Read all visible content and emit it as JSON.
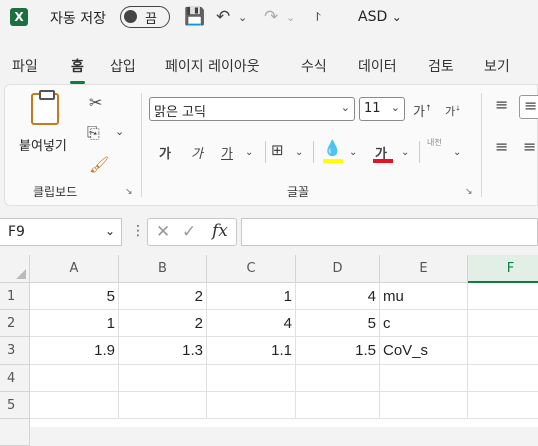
{
  "titlebar": {
    "app_logo": "X",
    "autosave_label": "자동 저장",
    "autosave_state": "끔",
    "doc_name": "ASD"
  },
  "menu": {
    "tabs": [
      "파일",
      "홈",
      "삽입",
      "페이지 레이아웃",
      "수식",
      "데이터",
      "검토",
      "보기"
    ],
    "active": "홈"
  },
  "ribbon": {
    "clipboard": {
      "paste_label": "붙여넣기",
      "group_label": "클립보드"
    },
    "font": {
      "family": "맑은 고딕",
      "size": "11",
      "grow_label": "가",
      "shrink_label": "가",
      "bold_label": "가",
      "italic_label": "가",
      "underline_label": "가",
      "font_color_label": "가",
      "phonetic_label": "내천",
      "group_label": "글꼴",
      "highlight_color": "#ffff00",
      "font_color": "#e81123"
    }
  },
  "formula_bar": {
    "name_box": "F9",
    "fx_label": "fx",
    "formula": ""
  },
  "sheet": {
    "columns": [
      "A",
      "B",
      "C",
      "D",
      "E",
      "F"
    ],
    "selected_column": "F",
    "rows": [
      "1",
      "2",
      "3",
      "4",
      "5"
    ],
    "cells": [
      [
        "5",
        "2",
        "1",
        "4",
        "mu",
        ""
      ],
      [
        "1",
        "2",
        "4",
        "5",
        "c",
        ""
      ],
      [
        "1.9",
        "1.3",
        "1.1",
        "1.5",
        "CoV_s",
        ""
      ],
      [
        "",
        "",
        "",
        "",
        "",
        ""
      ],
      [
        "",
        "",
        "",
        "",
        "",
        ""
      ]
    ]
  }
}
